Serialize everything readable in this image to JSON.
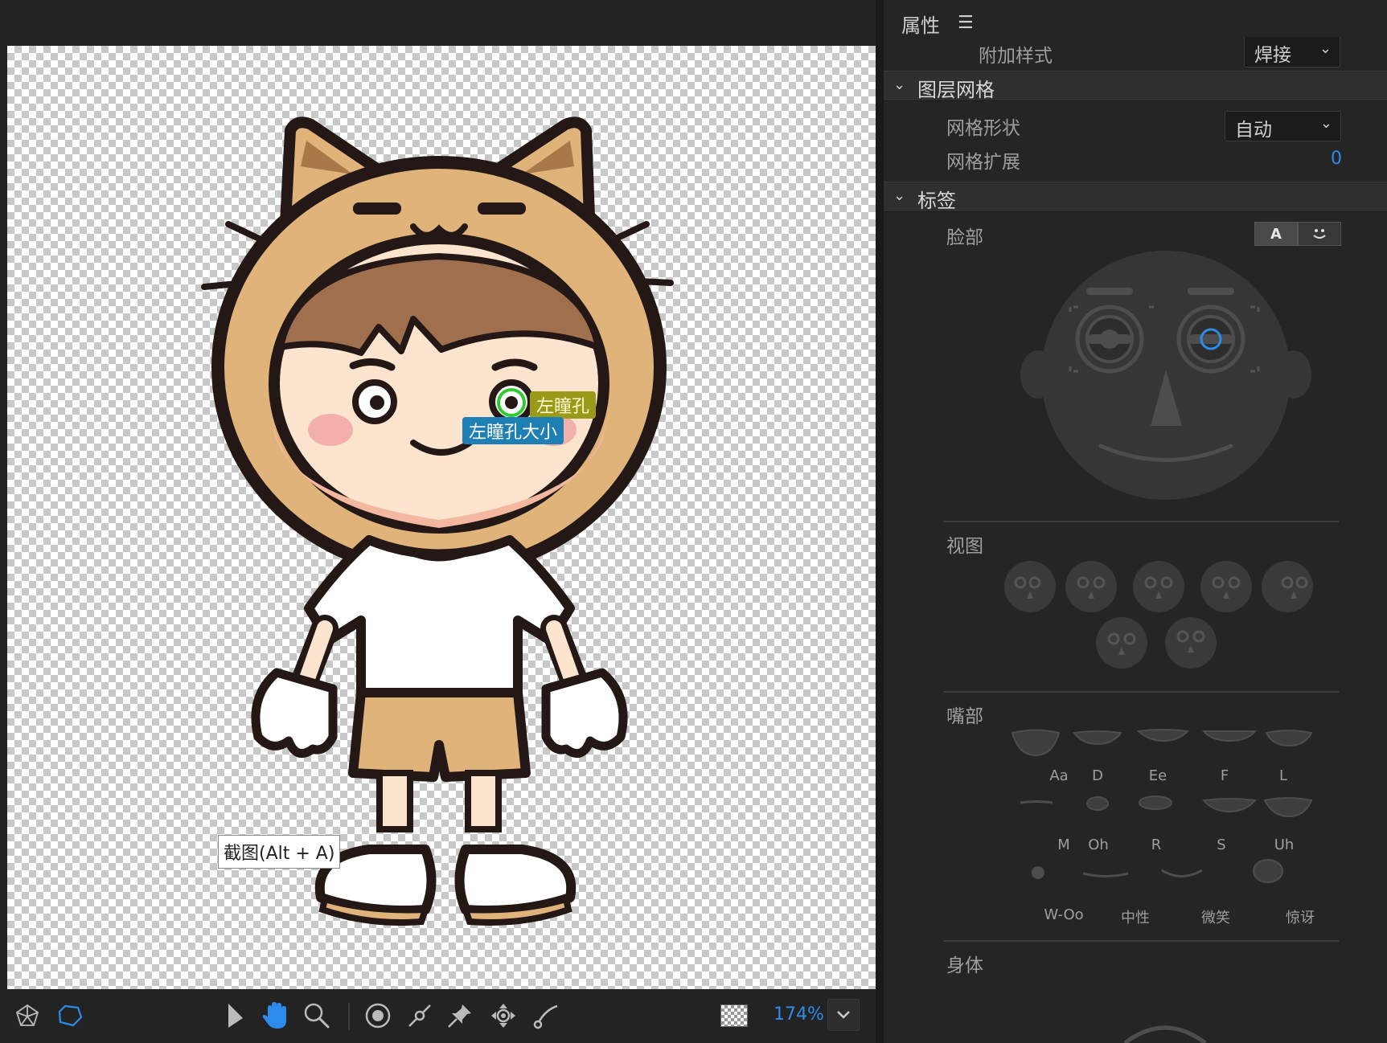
{
  "stage": {
    "tag_yellow": "左瞳孔",
    "tag_blue": "左瞳孔大小",
    "tooltip": "截图(Alt + A)",
    "zoom": "174%"
  },
  "panel": {
    "title": "属性",
    "attach_style_label": "附加样式",
    "attach_style_value": "焊接",
    "sections": {
      "layer_mesh": "图层网格",
      "tags": "标签"
    },
    "mesh_shape_label": "网格形状",
    "mesh_shape_value": "自动",
    "mesh_expand_label": "网格扩展",
    "mesh_expand_value": "0",
    "face_label": "脸部",
    "face_toggle_text": "A",
    "view_label": "视图",
    "mouth_label": "嘴部",
    "body_label": "身体",
    "mouths": [
      "Aa",
      "D",
      "Ee",
      "F",
      "L",
      "M",
      "Oh",
      "R",
      "S",
      "Uh",
      "W-Oo",
      "中性",
      "微笑",
      "惊讶"
    ]
  },
  "colors": {
    "accent_blue": "#2d8ceb",
    "tag_yellow_bg": "#9a9a1a",
    "tag_blue_bg": "#1d7fb3"
  },
  "icons": [
    "mesh-icon",
    "hexagon-icon",
    "select-arrow-icon",
    "hand-icon",
    "zoom-icon",
    "target-icon",
    "pin-line-icon",
    "pushpin-icon",
    "move-handle-icon",
    "stick-tool-icon",
    "checker-icon",
    "chevron-down-icon",
    "menu-icon"
  ]
}
